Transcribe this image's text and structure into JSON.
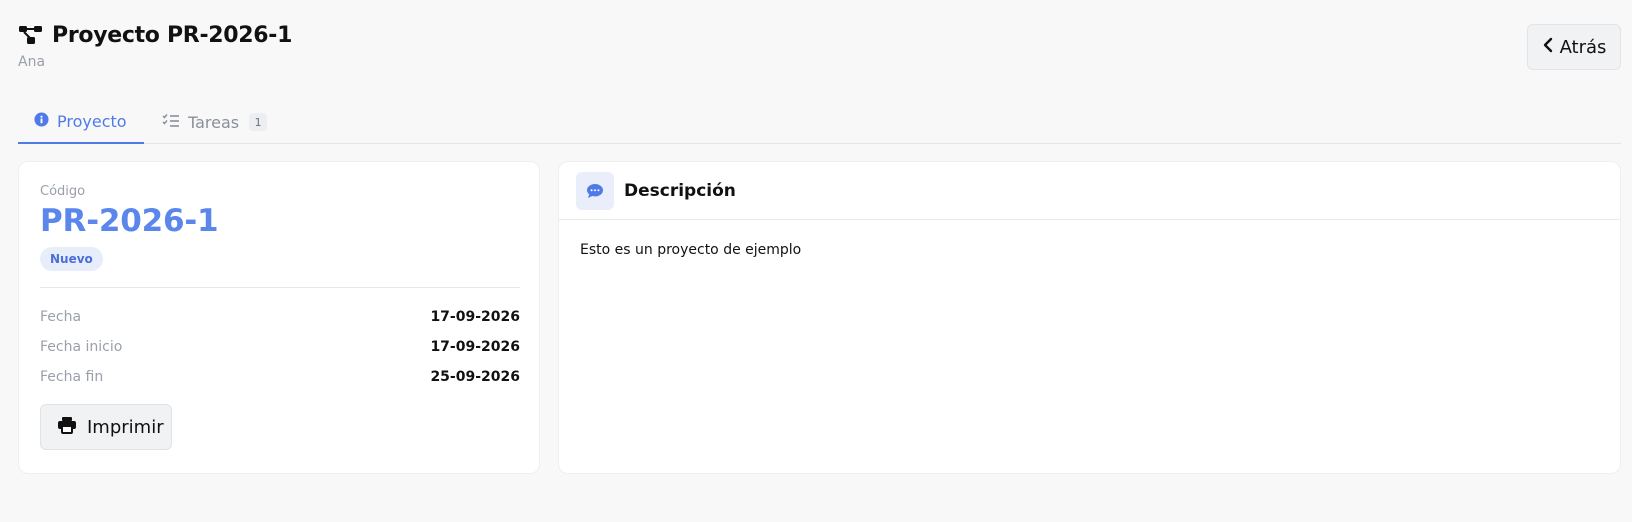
{
  "header": {
    "title": "Proyecto PR-2026-1",
    "subtitle": "Ana",
    "back_label": "Atrás"
  },
  "tabs": [
    {
      "label": "Proyecto",
      "icon": "info-icon",
      "active": true
    },
    {
      "label": "Tareas",
      "icon": "task-list-icon",
      "count": "1",
      "active": false
    }
  ],
  "summary": {
    "code_label": "Código",
    "code_value": "PR-2026-1",
    "status": "Nuevo",
    "rows": [
      {
        "label": "Fecha",
        "value": "17-09-2026"
      },
      {
        "label": "Fecha inicio",
        "value": "17-09-2026"
      },
      {
        "label": "Fecha fin",
        "value": "25-09-2026"
      }
    ],
    "print_label": "Imprimir"
  },
  "description": {
    "title": "Descripción",
    "text": "Esto es un proyecto de ejemplo"
  },
  "colors": {
    "accent": "#4f7ae8",
    "code": "#5b86ec",
    "badge_bg": "#e8edfc",
    "muted": "#9aa0aa"
  }
}
